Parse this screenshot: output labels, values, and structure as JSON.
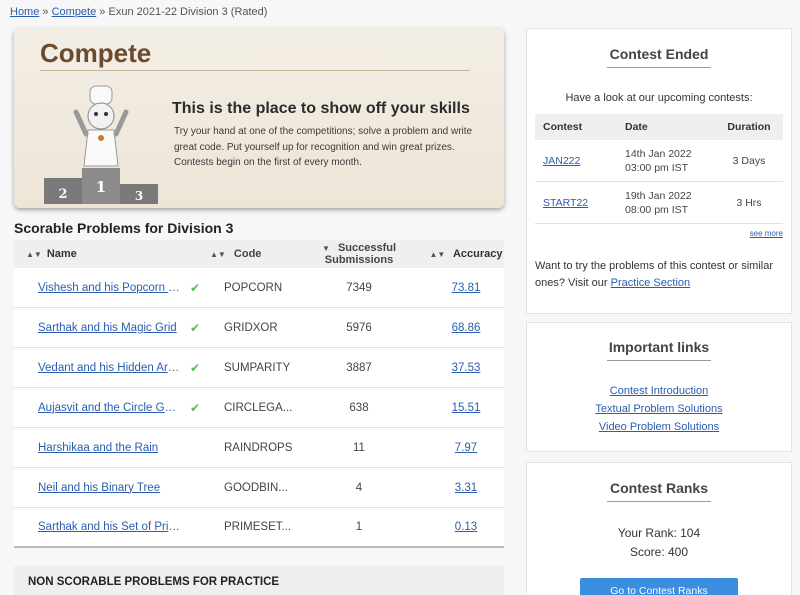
{
  "breadcrumb": {
    "home": "Home",
    "sep1": "»",
    "compete": "Compete",
    "sep2": "»",
    "current": "Exun 2021-22 Division 3 (Rated)"
  },
  "banner": {
    "title": "Compete",
    "headline": "This is the place to show off your skills",
    "text": "Try your hand at one of the competitions; solve a problem and write great code. Put yourself up for recognition and win great prizes. Contests begin on the first of every month.",
    "podium": [
      "2",
      "1",
      "3"
    ]
  },
  "problems": {
    "title": "Scorable Problems for Division 3",
    "headers": {
      "name": "Name",
      "code": "Code",
      "submissions": "Successful Submissions",
      "accuracy": "Accuracy"
    },
    "rows": [
      {
        "name": "Vishesh and his Popcorn Maker",
        "solved": "✔",
        "code": "POPCORN",
        "submissions": "7349",
        "accuracy": "73.81"
      },
      {
        "name": "Sarthak and his Magic Grid",
        "solved": "✔",
        "code": "GRIDXOR",
        "submissions": "5976",
        "accuracy": "68.86"
      },
      {
        "name": "Vedant and his Hidden Array",
        "solved": "✔",
        "code": "SUMPARITY",
        "submissions": "3887",
        "accuracy": "37.53"
      },
      {
        "name": "Aujasvit and the Circle Game",
        "solved": "✔",
        "code": "CIRCLEGA...",
        "submissions": "638",
        "accuracy": "15.51"
      },
      {
        "name": "Harshikaa and the Rain",
        "solved": "",
        "code": "RAINDROPS",
        "submissions": "11",
        "accuracy": "7.97"
      },
      {
        "name": "Neil and his Binary Tree",
        "solved": "",
        "code": "GOODBIN...",
        "submissions": "4",
        "accuracy": "3.31"
      },
      {
        "name": "Sarthak and his Set of Primes",
        "solved": "",
        "code": "PRIMESET...",
        "submissions": "1",
        "accuracy": "0.13"
      }
    ],
    "sort_icon_both": "▲▼",
    "sort_icon_down": "▼"
  },
  "non_scorable": {
    "title": "NON SCORABLE PROBLEMS FOR PRACTICE"
  },
  "contest_ended": {
    "title": "Contest Ended",
    "lead": "Have a look at our upcoming contests:",
    "headers": {
      "contest": "Contest",
      "date": "Date",
      "duration": "Duration"
    },
    "rows": [
      {
        "contest": "JAN222",
        "date1": "14th Jan 2022",
        "date2": "03:00 pm IST",
        "duration": "3 Days"
      },
      {
        "contest": "START22",
        "date1": "19th Jan 2022",
        "date2": "08:00 pm IST",
        "duration": "3 Hrs"
      }
    ],
    "see_more": "see more",
    "try_text": "Want to try the problems of this contest or similar ones? Visit our",
    "practice_link": "Practice Section"
  },
  "important_links": {
    "title": "Important links",
    "items": [
      "Contest Introduction",
      "Textual Problem Solutions",
      "Video Problem Solutions"
    ]
  },
  "contest_ranks": {
    "title": "Contest Ranks",
    "rank_label": "Your Rank:",
    "rank": "104",
    "score_label": "Score:",
    "score": "400",
    "button": "Go to Contest Ranks"
  },
  "colors": {
    "link": "#2a5db0",
    "check": "#5cb85c",
    "button": "#3b8de0",
    "banner_title": "#6b4a2e"
  },
  "icons": {
    "solved": "check-icon",
    "sort": "sort-icon"
  }
}
